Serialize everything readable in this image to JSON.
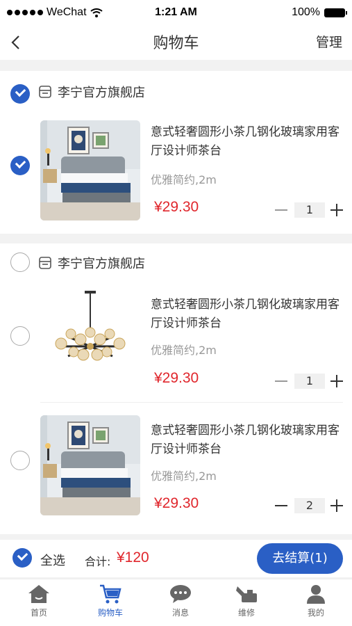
{
  "status_bar": {
    "carrier": "WeChat",
    "time": "1:21 AM",
    "battery": "100%"
  },
  "nav": {
    "title": "购物车",
    "manage": "管理"
  },
  "stores": [
    {
      "name": "李宁官方旗舰店",
      "checked": true,
      "items": [
        {
          "title": "意式轻奢圆形小茶几钢化玻璃家用客厅设计师茶台",
          "spec": "优雅简约,2m",
          "price": "¥29.30",
          "qty": "1",
          "checked": true,
          "image": "bed"
        }
      ]
    },
    {
      "name": "李宁官方旗舰店",
      "checked": false,
      "items": [
        {
          "title": "意式轻奢圆形小茶几钢化玻璃家用客厅设计师茶台",
          "spec": "优雅简约,2m",
          "price": "¥29.30",
          "qty": "1",
          "checked": false,
          "image": "chandelier"
        },
        {
          "title": "意式轻奢圆形小茶几钢化玻璃家用客厅设计师茶台",
          "spec": "优雅简约,2m",
          "price": "¥29.30",
          "qty": "2",
          "checked": false,
          "image": "bed"
        }
      ]
    }
  ],
  "footer": {
    "select_all": "全选",
    "total_label": "合计:",
    "total_value": "¥120",
    "checkout": "去结算(1)"
  },
  "tabs": [
    {
      "label": "首页",
      "icon": "home-icon"
    },
    {
      "label": "购物车",
      "icon": "cart-icon",
      "active": true
    },
    {
      "label": "消息",
      "icon": "chat-icon"
    },
    {
      "label": "维修",
      "icon": "repair-icon"
    },
    {
      "label": "我的",
      "icon": "person-icon"
    }
  ],
  "colors": {
    "accent": "#2a5fc5",
    "price": "#e0262c"
  }
}
